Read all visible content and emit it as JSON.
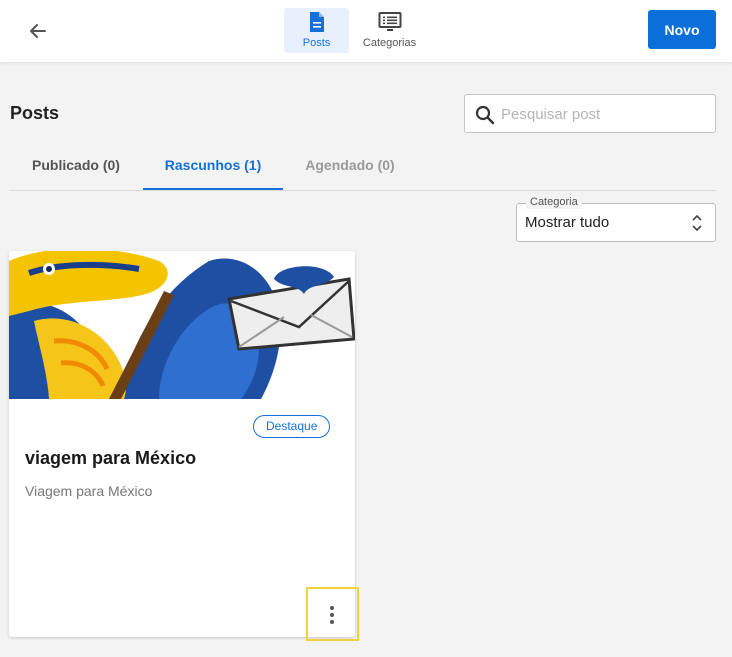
{
  "header": {
    "back_icon": "arrow-left-icon",
    "nav": [
      {
        "label": "Posts",
        "icon": "document-icon",
        "active": true
      },
      {
        "label": "Categorias",
        "icon": "monitor-list-icon",
        "active": false
      }
    ],
    "new_button": "Novo"
  },
  "page": {
    "title": "Posts",
    "search": {
      "placeholder": "Pesquisar post",
      "value": ""
    },
    "tabs": [
      {
        "label": "Publicado (0)",
        "active": false
      },
      {
        "label": "Rascunhos (1)",
        "active": true
      },
      {
        "label": "Agendado (0)",
        "active": false
      }
    ],
    "category": {
      "legend": "Categoria",
      "value": "Mostrar tudo"
    }
  },
  "cards": [
    {
      "badge": "Destaque",
      "title": "viagem para México",
      "excerpt": "Viagem para México",
      "menu_icon": "vertical-dots-icon"
    }
  ],
  "colors": {
    "accent": "#0a6fd8",
    "highlight": "#f0d23c"
  }
}
